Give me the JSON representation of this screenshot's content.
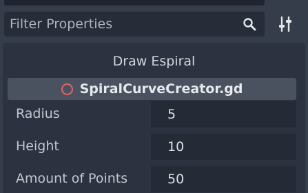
{
  "inspector": {
    "filter": {
      "placeholder": "Filter Properties",
      "value": ""
    },
    "icons": {
      "search": "search-icon",
      "tools": "sliders-icon",
      "script": "circle-outline-icon"
    },
    "section_title": "Draw Espiral",
    "script_file": "SpiralCurveCreator.gd",
    "properties": [
      {
        "label": "Radius",
        "value": "5"
      },
      {
        "label": "Height",
        "value": "10"
      },
      {
        "label": "Amount of Points",
        "value": "50"
      }
    ]
  },
  "colors": {
    "background": "#363d4a",
    "panel": "#2c3240",
    "field": "#252b36",
    "script_bar": "#4a5260",
    "script_icon": "#e06666"
  }
}
